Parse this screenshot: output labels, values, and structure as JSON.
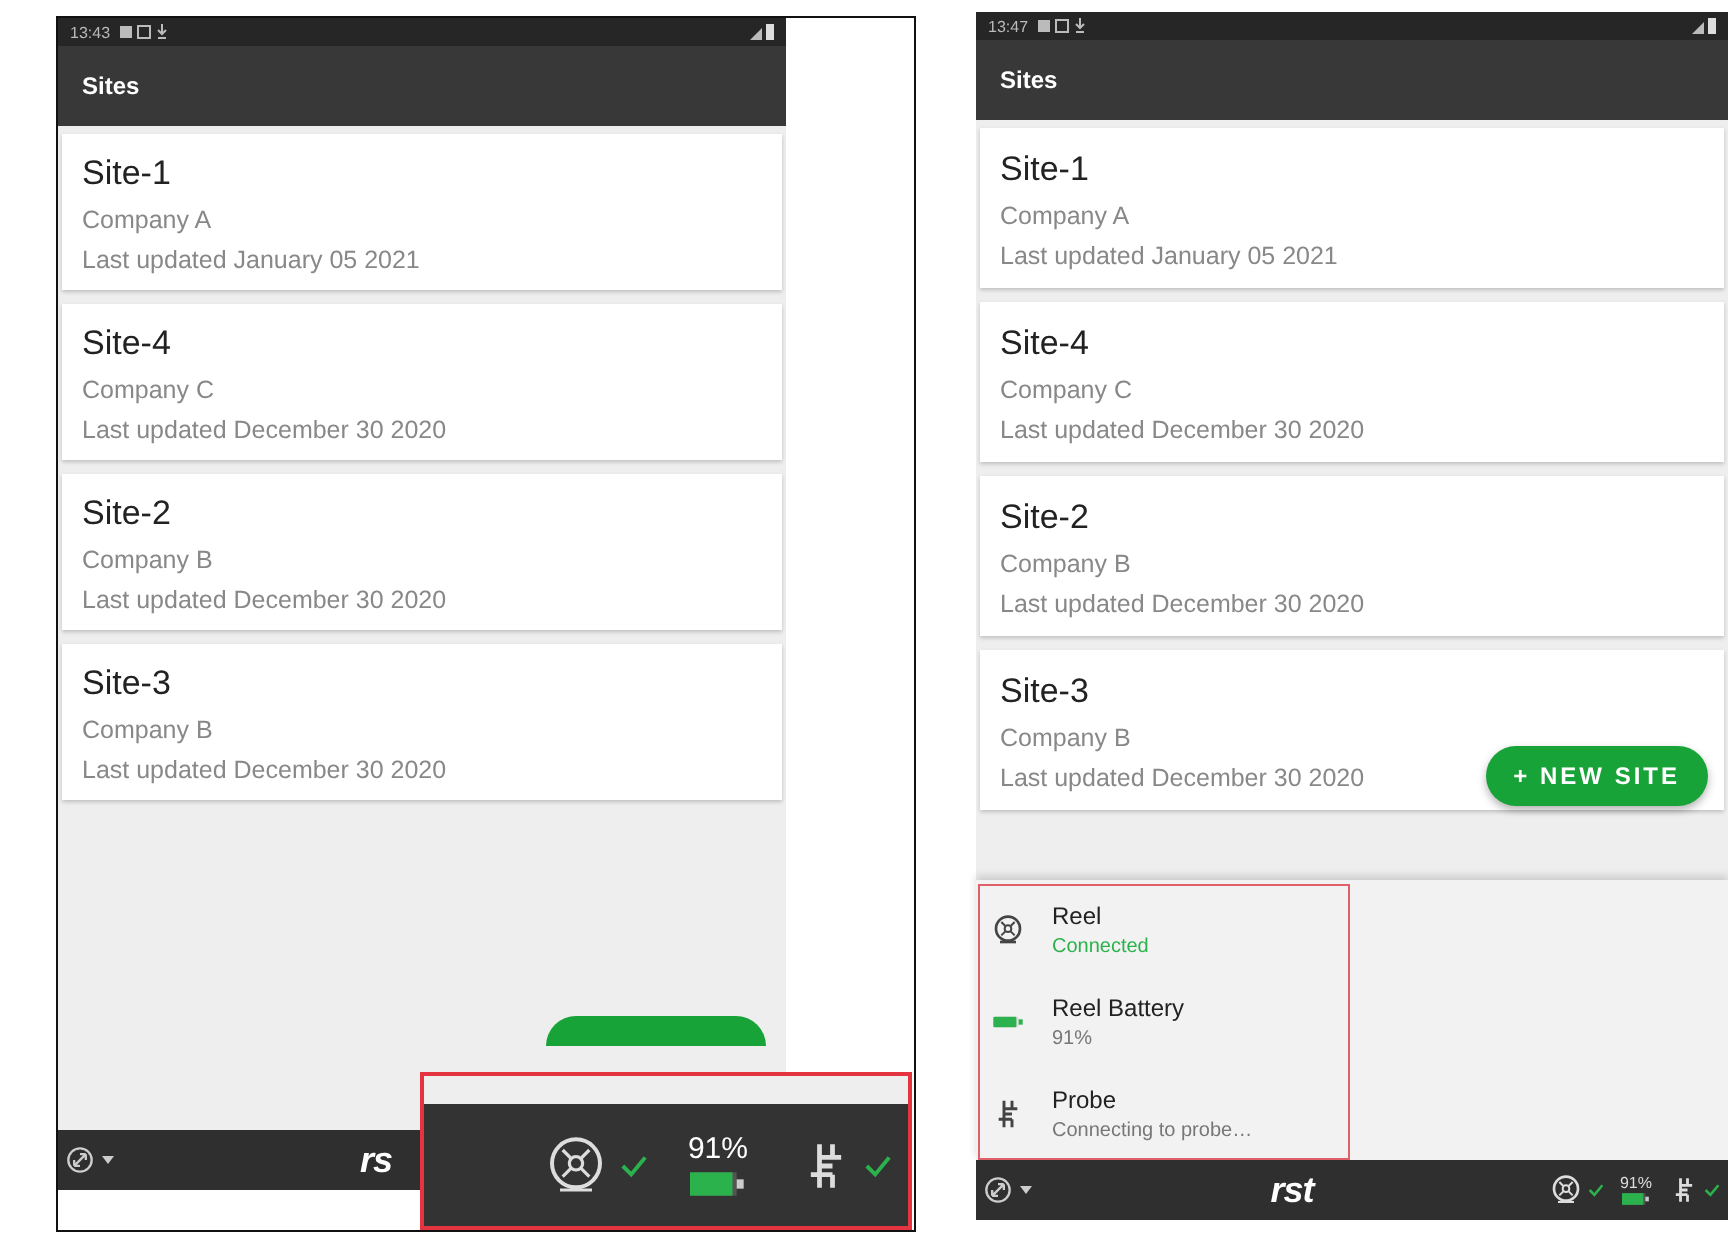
{
  "screens": [
    {
      "status_bar": {
        "time": "13:43"
      },
      "app_bar": {
        "title": "Sites"
      },
      "sites": [
        {
          "name": "Site-1",
          "company": "Company A",
          "updated": "Last updated January 05 2021"
        },
        {
          "name": "Site-4",
          "company": "Company C",
          "updated": "Last updated December 30 2020"
        },
        {
          "name": "Site-2",
          "company": "Company B",
          "updated": "Last updated December 30 2020"
        },
        {
          "name": "Site-3",
          "company": "Company B",
          "updated": "Last updated December 30 2020"
        }
      ],
      "fab": {
        "kind": "partial"
      },
      "bottom_bar": {
        "logo": "rs"
      },
      "callout": {
        "devices": [
          {
            "kind": "reel",
            "ok": true
          },
          {
            "kind": "battery",
            "reading": "91%",
            "level": 0.91
          },
          {
            "kind": "probe",
            "ok": true
          }
        ]
      }
    },
    {
      "status_bar": {
        "time": "13:47"
      },
      "app_bar": {
        "title": "Sites"
      },
      "sites": [
        {
          "name": "Site-1",
          "company": "Company A",
          "updated": "Last updated January 05 2021"
        },
        {
          "name": "Site-4",
          "company": "Company C",
          "updated": "Last updated December 30 2020"
        },
        {
          "name": "Site-2",
          "company": "Company B",
          "updated": "Last updated December 30 2020"
        },
        {
          "name": "Site-3",
          "company": "Company B",
          "updated": "Last updated December 30 2020"
        }
      ],
      "fab": {
        "kind": "full",
        "label": "+ NEW SITE"
      },
      "device_sheet": {
        "highlighted": true,
        "rows": [
          {
            "kind": "reel",
            "title": "Reel",
            "status": "Connected",
            "color": "#2bb24c"
          },
          {
            "kind": "battery",
            "title": "Reel Battery",
            "status": "91%",
            "color": "#777777",
            "level": 0.91
          },
          {
            "kind": "probe",
            "title": "Probe",
            "status": "Connecting to probe…",
            "color": "#777777"
          }
        ]
      },
      "bottom_bar": {
        "logo": "rst",
        "devices": [
          {
            "kind": "reel",
            "ok": true
          },
          {
            "kind": "battery",
            "reading": "91%",
            "level": 0.91
          },
          {
            "kind": "probe",
            "ok": true
          }
        ]
      }
    }
  ]
}
